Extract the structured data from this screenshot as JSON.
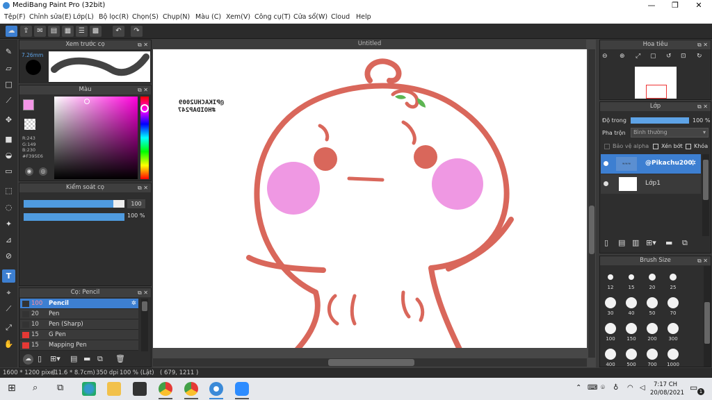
{
  "window": {
    "title": "MediBang Paint Pro (32bit)",
    "min": "—",
    "max": "❐",
    "close": "✕"
  },
  "menu": [
    "Tệp(F)",
    "Chỉnh sửa(E)",
    "Lớp(L)",
    "Bộ lọc(R)",
    "Chọn(S)",
    "Chụp(N)",
    "Màu (C)",
    "Xem(V)",
    "Công cụ(T)",
    "Cửa sổ(W)",
    "Cloud",
    "Help"
  ],
  "brush_preview": {
    "title": "Xem trước cọ",
    "size": "7.26mm"
  },
  "color_panel": {
    "title": "Màu",
    "r": "R:243",
    "g": "G:149",
    "b": "B:230",
    "hex": "#F395E6",
    "primary": "#F395E6",
    "secondary": "#ffffff"
  },
  "brush_control": {
    "title": "Kiểm soát cọ",
    "size_value": "100",
    "opacity_value": "100 %"
  },
  "brush_panel": {
    "title": "Cọ: Pencil",
    "items": [
      {
        "size": "100",
        "name": "Pencil",
        "color": "#333333",
        "selected": true
      },
      {
        "size": "20",
        "name": "Pen",
        "color": "#333333"
      },
      {
        "size": "10",
        "name": "Pen (Sharp)",
        "color": "#333333"
      },
      {
        "size": "15",
        "name": "G Pen",
        "color": "#e53935"
      },
      {
        "size": "15",
        "name": "Mapping Pen",
        "color": "#e53935"
      }
    ]
  },
  "canvas": {
    "tab_title": "Untitled",
    "watermark_line1": "@PIKACHU2009",
    "watermark_line2": "#HOIDAP247"
  },
  "navigator": {
    "title": "Hoa tiêu"
  },
  "layer_panel": {
    "title": "Lớp",
    "opacity_label": "Độ trong",
    "opacity_value": "100 %",
    "blend_label": "Pha trộn",
    "blend_value": "Bình thường",
    "protect_alpha": "Bảo vệ alpha",
    "clipping": "Xén bớt",
    "lock": "Khóa",
    "layers": [
      {
        "name": "@Pikachu200",
        "selected": true
      },
      {
        "name": "Lớp1",
        "selected": false
      }
    ]
  },
  "brush_size_panel": {
    "title": "Brush Size",
    "sizes": [
      "12",
      "15",
      "20",
      "25",
      "30",
      "40",
      "50",
      "70",
      "100",
      "150",
      "200",
      "300",
      "400",
      "500",
      "700",
      "1000"
    ]
  },
  "status": {
    "dimensions": "1600 * 1200 pixel",
    "physical": "(11.6 * 8.7cm)",
    "dpi": "350 dpi",
    "zoom": "100 % (Lật)",
    "cursor": "( 679, 1211 )"
  },
  "taskbar": {
    "time": "7:17 CH",
    "date": "20/08/2021",
    "notification_count": "1"
  }
}
